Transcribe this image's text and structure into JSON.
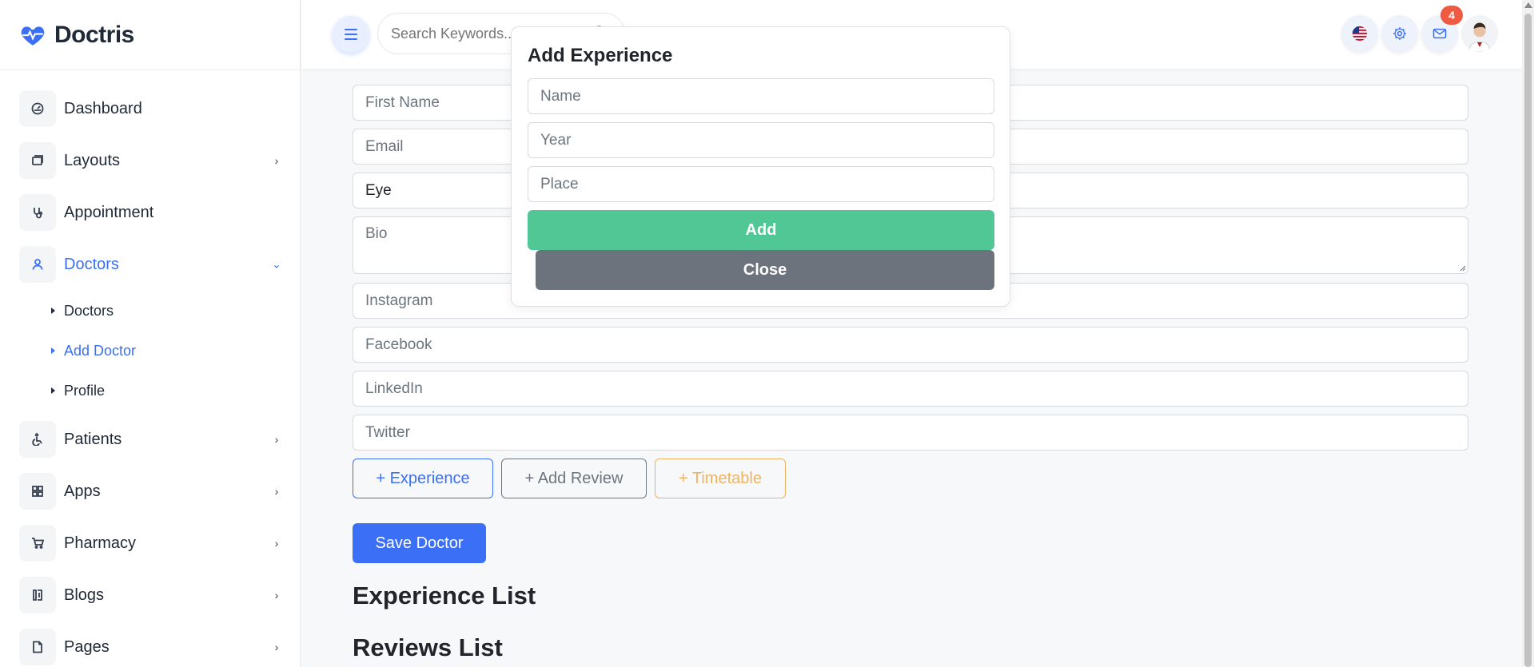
{
  "brand": {
    "name": "Doctris",
    "logo_icon": "heart-pulse-icon",
    "accent_color": "#3b6ff5"
  },
  "sidebar": {
    "items": [
      {
        "label": "Dashboard",
        "icon": "dashboard-icon",
        "has_chevron": false
      },
      {
        "label": "Layouts",
        "icon": "layouts-icon",
        "has_chevron": true
      },
      {
        "label": "Appointment",
        "icon": "stethoscope-icon",
        "has_chevron": false
      },
      {
        "label": "Doctors",
        "icon": "user-icon",
        "has_chevron": true,
        "active": true
      },
      {
        "label": "Patients",
        "icon": "wheelchair-icon",
        "has_chevron": true
      },
      {
        "label": "Apps",
        "icon": "apps-grid-icon",
        "has_chevron": true
      },
      {
        "label": "Pharmacy",
        "icon": "cart-icon",
        "has_chevron": true
      },
      {
        "label": "Blogs",
        "icon": "blog-icon",
        "has_chevron": true
      },
      {
        "label": "Pages",
        "icon": "file-icon",
        "has_chevron": true
      }
    ],
    "doctors_submenu": [
      {
        "label": "Doctors"
      },
      {
        "label": "Add Doctor",
        "active": true
      },
      {
        "label": "Profile"
      }
    ]
  },
  "topbar": {
    "search_placeholder": "Search Keywords...",
    "language_flag": "us-flag-icon",
    "settings_icon": "gear-icon",
    "mail_icon": "mail-icon",
    "mail_badge": "4",
    "badge_color": "#ef5b42"
  },
  "form": {
    "first_name_placeholder": "First Name",
    "email_placeholder": "Email",
    "department_value": "Eye",
    "bio_placeholder": "Bio",
    "instagram_placeholder": "Instagram",
    "facebook_placeholder": "Facebook",
    "linkedin_placeholder": "LinkedIn",
    "twitter_placeholder": "Twitter",
    "experience_button": "+ Experience",
    "review_button": "+ Add Review",
    "timetable_button": "+ Timetable",
    "save_button": "Save Doctor",
    "experience_list_title": "Experience List",
    "reviews_list_title": "Reviews List"
  },
  "modal": {
    "title": "Add Experience",
    "name_placeholder": "Name",
    "year_placeholder": "Year",
    "place_placeholder": "Place",
    "add_label": "Add",
    "close_label": "Close",
    "add_color": "#52c796",
    "close_color": "#6c737c"
  }
}
